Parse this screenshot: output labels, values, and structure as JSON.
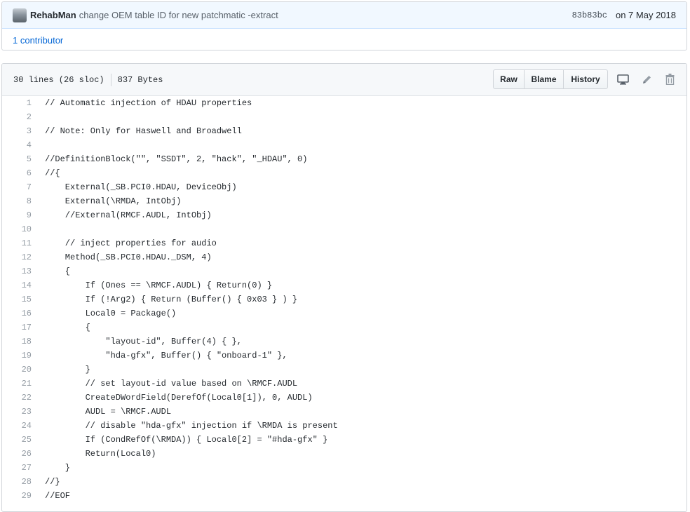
{
  "commit": {
    "author": "RehabMan",
    "message": "change OEM table ID for new patchmatic -extract",
    "sha": "83b83bc",
    "date": "on 7 May 2018",
    "contributors": "1 contributor"
  },
  "file": {
    "lines_info": "30 lines (26 sloc)",
    "size": "837 Bytes",
    "buttons": {
      "raw": "Raw",
      "blame": "Blame",
      "history": "History"
    },
    "icons": [
      "desktop-icon",
      "pencil-icon",
      "trash-icon"
    ]
  },
  "code": [
    {
      "n": "1",
      "t": "// Automatic injection of HDAU properties"
    },
    {
      "n": "2",
      "t": ""
    },
    {
      "n": "3",
      "t": "// Note: Only for Haswell and Broadwell"
    },
    {
      "n": "4",
      "t": ""
    },
    {
      "n": "5",
      "t": "//DefinitionBlock(\"\", \"SSDT\", 2, \"hack\", \"_HDAU\", 0)"
    },
    {
      "n": "6",
      "t": "//{"
    },
    {
      "n": "7",
      "t": "    External(_SB.PCI0.HDAU, DeviceObj)"
    },
    {
      "n": "8",
      "t": "    External(\\RMDA, IntObj)"
    },
    {
      "n": "9",
      "t": "    //External(RMCF.AUDL, IntObj)"
    },
    {
      "n": "10",
      "t": ""
    },
    {
      "n": "11",
      "t": "    // inject properties for audio"
    },
    {
      "n": "12",
      "t": "    Method(_SB.PCI0.HDAU._DSM, 4)"
    },
    {
      "n": "13",
      "t": "    {"
    },
    {
      "n": "14",
      "t": "        If (Ones == \\RMCF.AUDL) { Return(0) }"
    },
    {
      "n": "15",
      "t": "        If (!Arg2) { Return (Buffer() { 0x03 } ) }"
    },
    {
      "n": "16",
      "t": "        Local0 = Package()"
    },
    {
      "n": "17",
      "t": "        {"
    },
    {
      "n": "18",
      "t": "            \"layout-id\", Buffer(4) { },"
    },
    {
      "n": "19",
      "t": "            \"hda-gfx\", Buffer() { \"onboard-1\" },"
    },
    {
      "n": "20",
      "t": "        }"
    },
    {
      "n": "21",
      "t": "        // set layout-id value based on \\RMCF.AUDL"
    },
    {
      "n": "22",
      "t": "        CreateDWordField(DerefOf(Local0[1]), 0, AUDL)"
    },
    {
      "n": "23",
      "t": "        AUDL = \\RMCF.AUDL"
    },
    {
      "n": "24",
      "t": "        // disable \"hda-gfx\" injection if \\RMDA is present"
    },
    {
      "n": "25",
      "t": "        If (CondRefOf(\\RMDA)) { Local0[2] = \"#hda-gfx\" }"
    },
    {
      "n": "26",
      "t": "        Return(Local0)"
    },
    {
      "n": "27",
      "t": "    }"
    },
    {
      "n": "28",
      "t": "//}"
    },
    {
      "n": "29",
      "t": "//EOF"
    }
  ]
}
